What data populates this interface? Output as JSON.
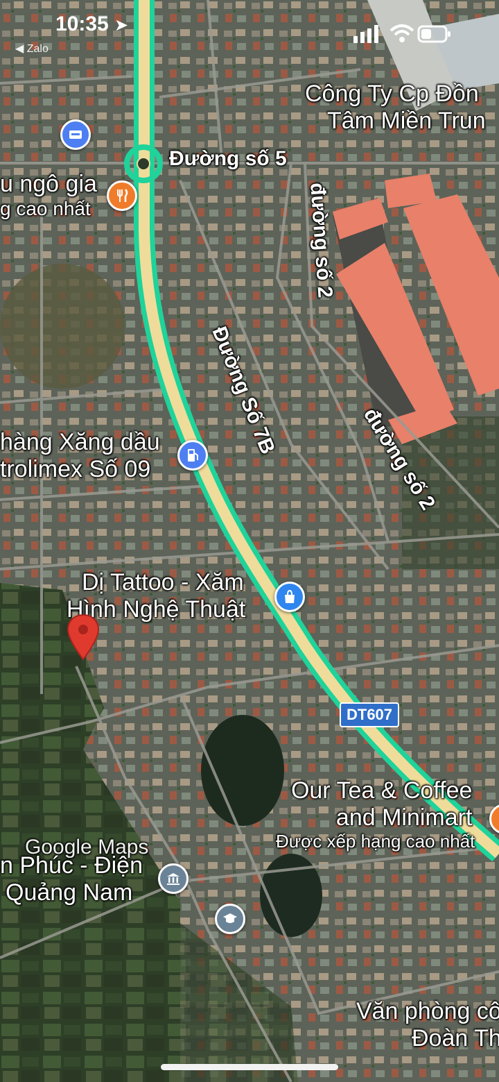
{
  "status_bar": {
    "time": "10:35",
    "back_app": "◀ Zalo"
  },
  "places": {
    "company": [
      "Công Ty Cp Đồn",
      "Tâm Miền Trun"
    ],
    "restaurant": [
      "u ngô gia",
      "g cao nhất"
    ],
    "gas_station": [
      "hàng Xăng dầu",
      "trolimex Số 09"
    ],
    "tattoo": [
      "Dị Tattoo - Xăm",
      "Hình Nghệ Thuật"
    ],
    "tea_shop": [
      "Our Tea & Coffee",
      "and Minimart",
      "Được xếp hạng cao nhất"
    ],
    "hall": [
      "n Phúc - Điện",
      "Quảng Nam"
    ],
    "office": [
      "Văn phòng cô",
      "Đoàn Th"
    ]
  },
  "roads": {
    "road5": "Đường số 5",
    "road2a": "đường số 2",
    "road2b": "đường số 2",
    "road7b": "Đường Số 7B",
    "shield": "DT607"
  },
  "watermark": "Google Maps",
  "colors": {
    "highway": "#1fd39a",
    "highway_fill": "#f0dc9a",
    "roof": "#e8806a",
    "pin_red": "#e03a2e",
    "poi_blue": "#4d7ff2",
    "poi_orange": "#f07c2b",
    "poi_gray": "#6b8396"
  }
}
